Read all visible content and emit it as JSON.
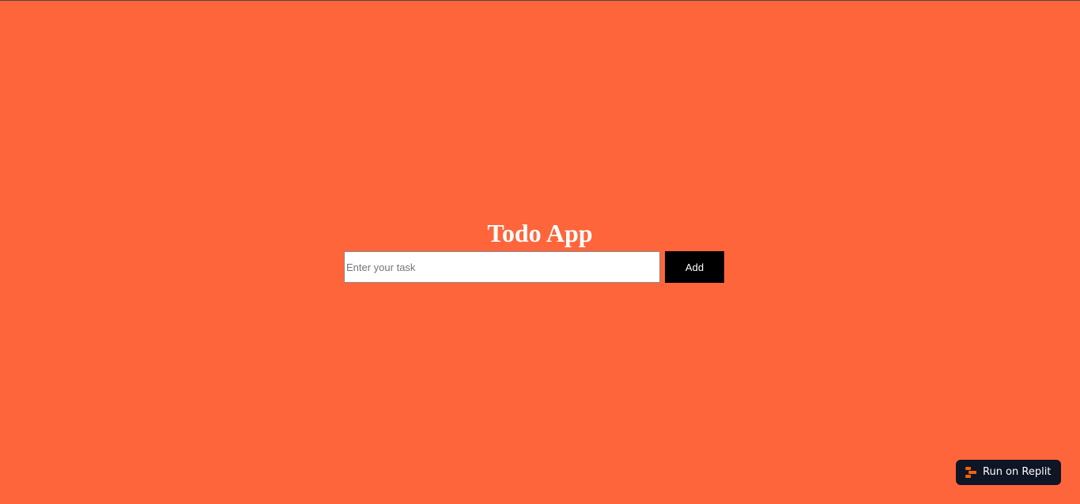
{
  "app": {
    "title": "Todo App",
    "background_color": "#ff653b"
  },
  "task_form": {
    "input_placeholder": "Enter your task",
    "input_value": "",
    "add_button_label": "Add",
    "add_button_color": "#000000"
  },
  "replit_badge": {
    "label": "Run on Replit",
    "icon": "replit-logo-icon",
    "background_color": "#0e1525",
    "icon_color": "#f26207"
  }
}
